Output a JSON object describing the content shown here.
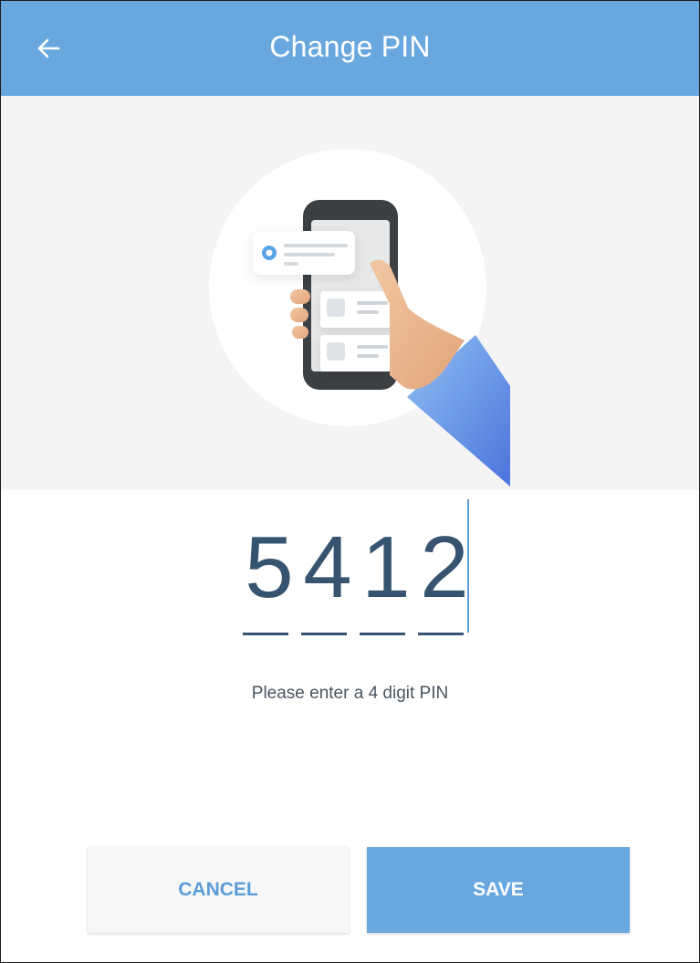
{
  "app_bar": {
    "title": "Change PIN",
    "back_icon": "arrow-left-icon",
    "background_color": "#69a8df"
  },
  "illustration": {
    "subject": "hand-holding-phone-illustration"
  },
  "pin_entry": {
    "digits": [
      "5",
      "4",
      "1",
      "2"
    ],
    "hint": "Please enter a 4 digit PIN"
  },
  "actions": {
    "cancel_label": "CANCEL",
    "save_label": "SAVE"
  },
  "colors": {
    "accent": "#69a8df",
    "digit_text": "#36546f",
    "cancel_text": "#5c9cd6"
  }
}
